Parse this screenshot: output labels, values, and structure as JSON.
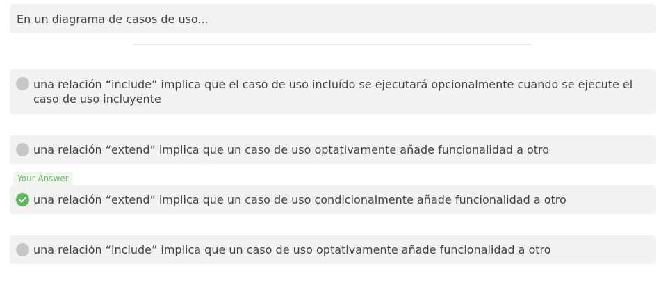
{
  "question": {
    "text": "En un diagrama de casos de uso..."
  },
  "badge": {
    "label": "Your Answer"
  },
  "options": [
    {
      "text": "una relación “include” implica que el caso de uso incluído se ejecutará opcionalmente cuando se ejecute el caso de uso incluyente",
      "selected": false
    },
    {
      "text": "una relación “extend” implica que un caso de uso optativamente añade funcionalidad a otro",
      "selected": false
    },
    {
      "text": "una relación “extend” implica que un caso de uso condicionalmente añade funcionalidad a otro",
      "selected": true
    },
    {
      "text": "una relación “include” implica que un caso de uso optativamente añade funcionalidad a otro",
      "selected": false
    }
  ],
  "colors": {
    "option_background": "#f2f2f2",
    "radio_unselected": "#c6c6c6",
    "correct_green": "#5cb85c",
    "badge_text": "#6cb96c",
    "text": "#444444"
  },
  "icons": {
    "unselected": "radio-unselected-icon",
    "selected": "check-circle-icon"
  }
}
